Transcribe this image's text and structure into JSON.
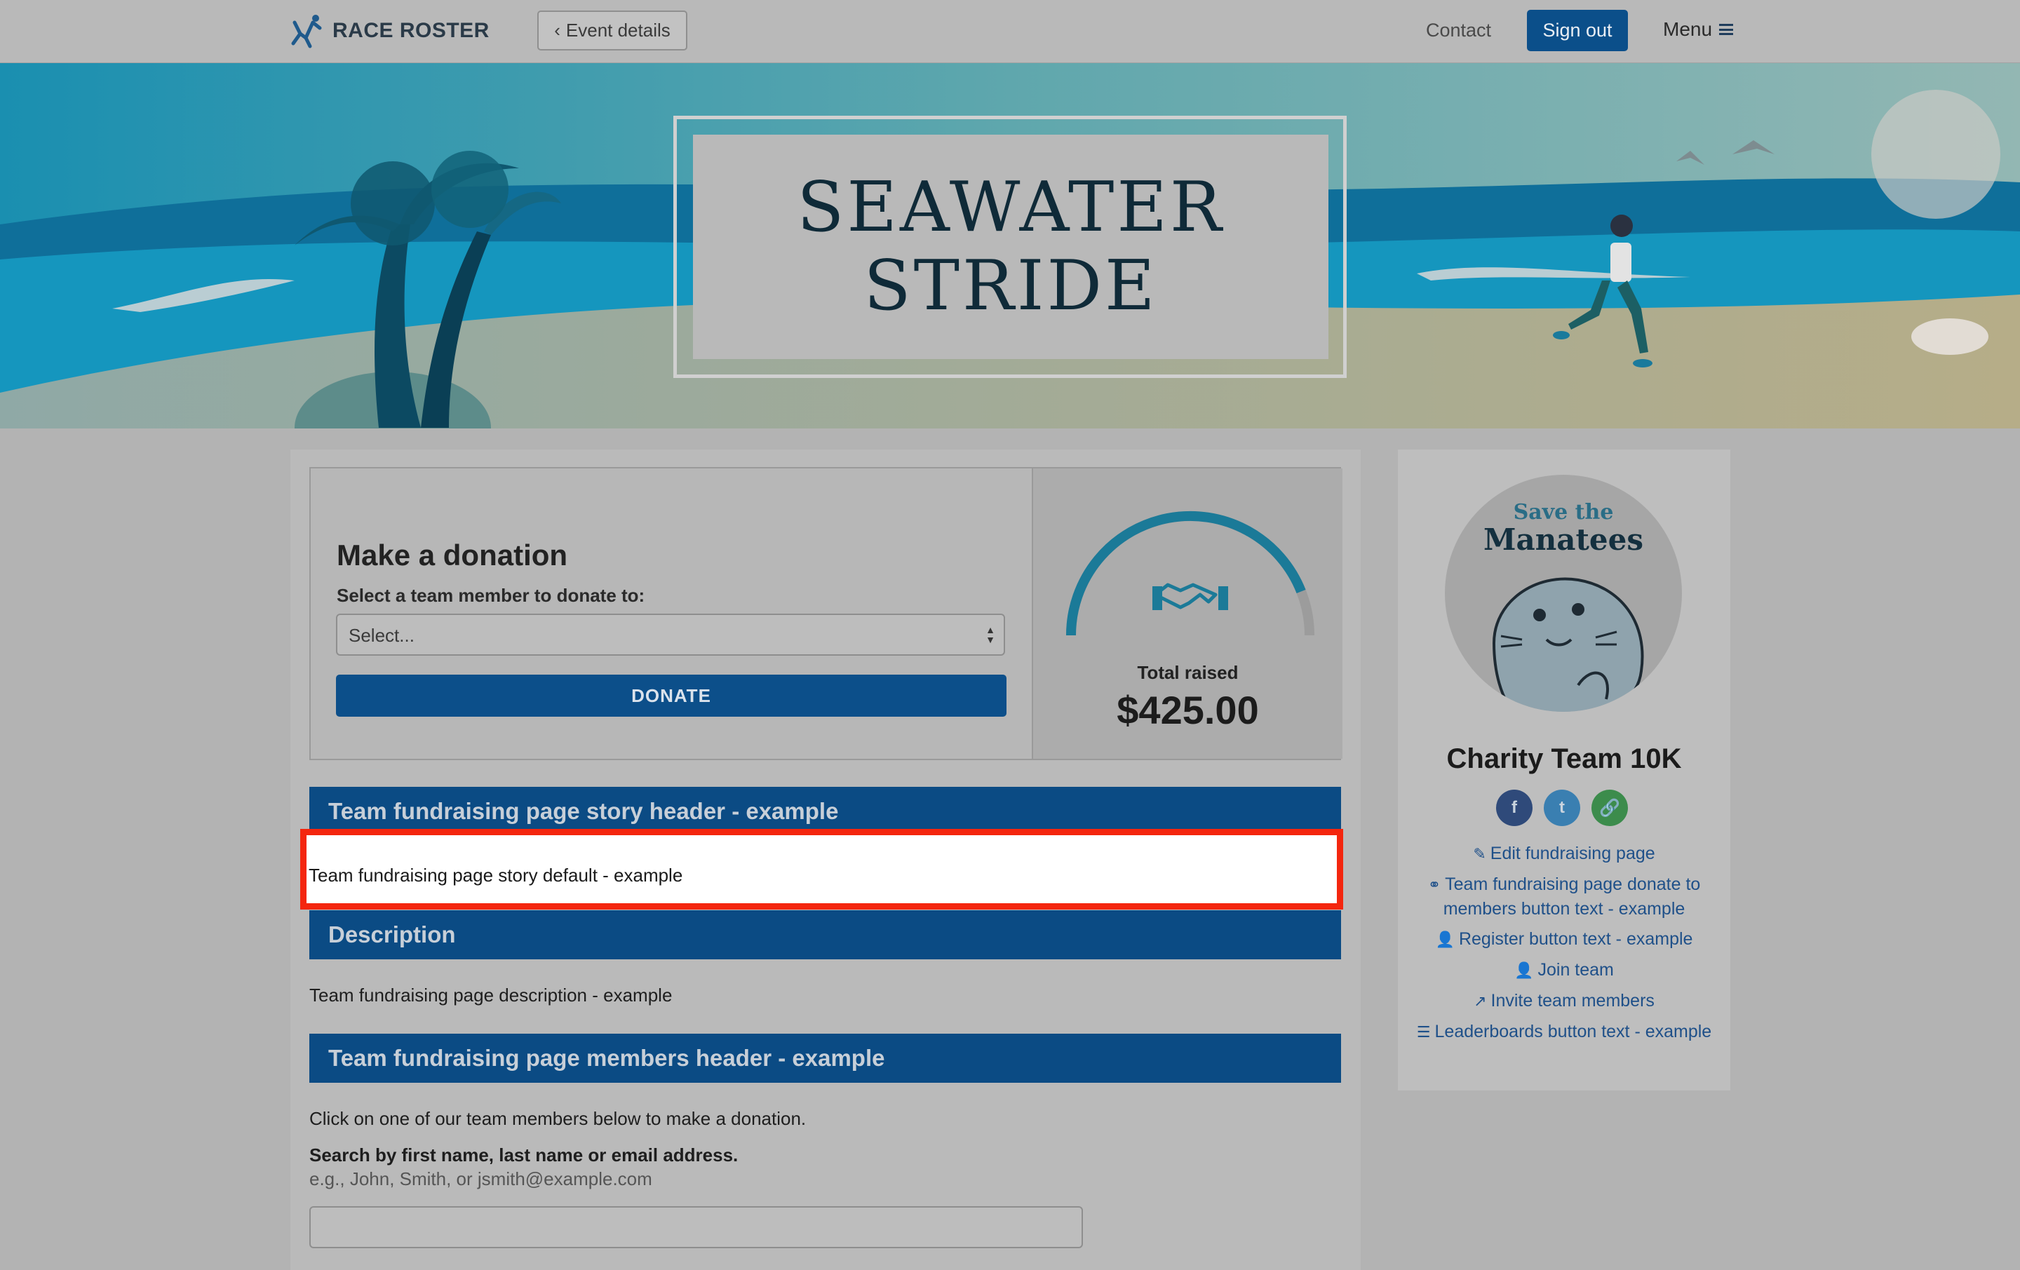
{
  "header": {
    "brand": "RACE ROSTER",
    "back_label": "Event details",
    "contact": "Contact",
    "sign_out": "Sign out",
    "menu": "Menu"
  },
  "hero": {
    "title_line1": "SEAWATER",
    "title_line2": "STRIDE"
  },
  "donation": {
    "title": "Make a donation",
    "select_label": "Select a team member to donate to:",
    "select_value": "Select...",
    "donate_button": "DONATE",
    "total_label": "Total raised",
    "total_amount": "$425.00",
    "progress_fraction": 0.88
  },
  "sections": {
    "story_header": "Team fundraising page story header - example",
    "story_text": "Team fundraising page story default - example",
    "description_header": "Description",
    "description_text": "Team fundraising page description - example",
    "members_header": "Team fundraising page members header - example",
    "members_intro": "Click on one of our team members below to make a donation.",
    "search_label": "Search by first name, last name or email address.",
    "search_hint": "e.g., John, Smith, or jsmith@example.com",
    "search_value": ""
  },
  "sidebar": {
    "avatar_line1": "Save the",
    "avatar_line2": "Manatees",
    "team_name": "Charity Team 10K",
    "social": {
      "facebook": "f",
      "twitter": "t",
      "link": "🔗"
    },
    "links": [
      {
        "icon": "pencil-icon",
        "label": "Edit fundraising page"
      },
      {
        "icon": "handshake-icon",
        "label": "Team fundraising page donate to members button text - example"
      },
      {
        "icon": "user-plus-icon",
        "label": "Register button text - example"
      },
      {
        "icon": "user-plus-icon",
        "label": "Join team"
      },
      {
        "icon": "share-icon",
        "label": "Invite team members"
      },
      {
        "icon": "list-icon",
        "label": "Leaderboards button text - example"
      }
    ]
  },
  "colors": {
    "primary": "#0b4b84",
    "highlight_border": "#f4260e",
    "gauge_fill": "#1b7a98",
    "gauge_track": "#9c9c9c"
  }
}
